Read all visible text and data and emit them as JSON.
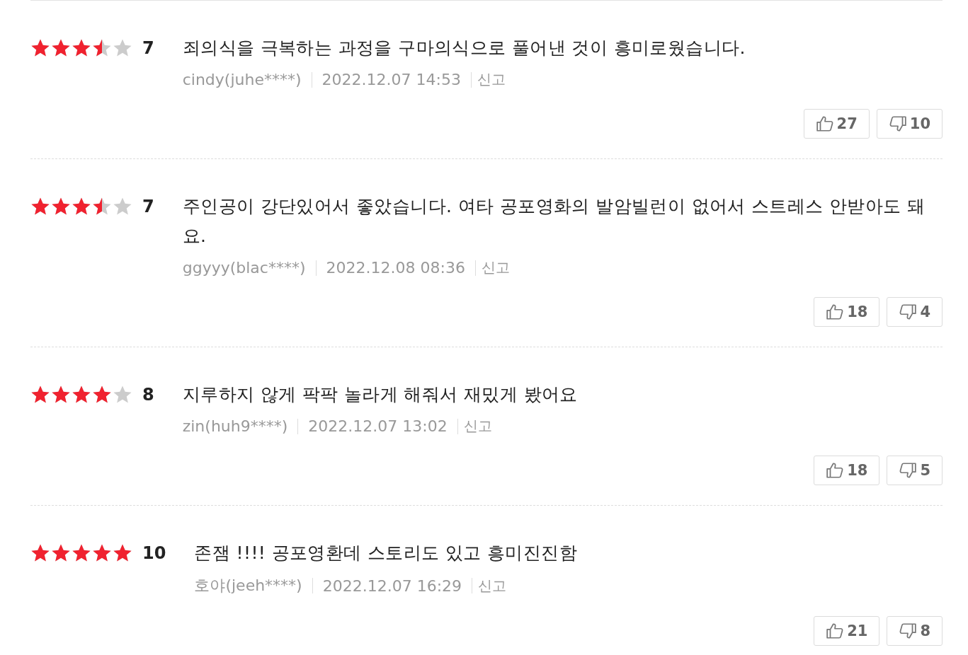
{
  "reviews": [
    {
      "stars": 3.5,
      "score": "7",
      "text": "죄의식을 극복하는 과정을 구마의식으로 풀어낸 것이 흥미로웠습니다.",
      "author": "cindy(juhe****)",
      "date": "2022.12.07 14:53",
      "report": "신고",
      "likes": "27",
      "dislikes": "10"
    },
    {
      "stars": 3.5,
      "score": "7",
      "text": "주인공이 강단있어서 좋았습니다. 여타 공포영화의 발암빌런이 없어서 스트레스 안받아도 돼요.",
      "author": "ggyyy(blac****)",
      "date": "2022.12.08 08:36",
      "report": "신고",
      "likes": "18",
      "dislikes": "4"
    },
    {
      "stars": 4,
      "score": "8",
      "text": "지루하지 않게 팍팍 놀라게 해줘서 재밌게 봤어요",
      "author": "zin(huh9****)",
      "date": "2022.12.07 13:02",
      "report": "신고",
      "likes": "18",
      "dislikes": "5"
    },
    {
      "stars": 5,
      "score": "10",
      "text": "존잼 !!!! 공포영환데 스토리도 있고 흥미진진함",
      "author": "호야(jeeh****)",
      "date": "2022.12.07 16:29",
      "report": "신고",
      "likes": "21",
      "dislikes": "8"
    }
  ]
}
